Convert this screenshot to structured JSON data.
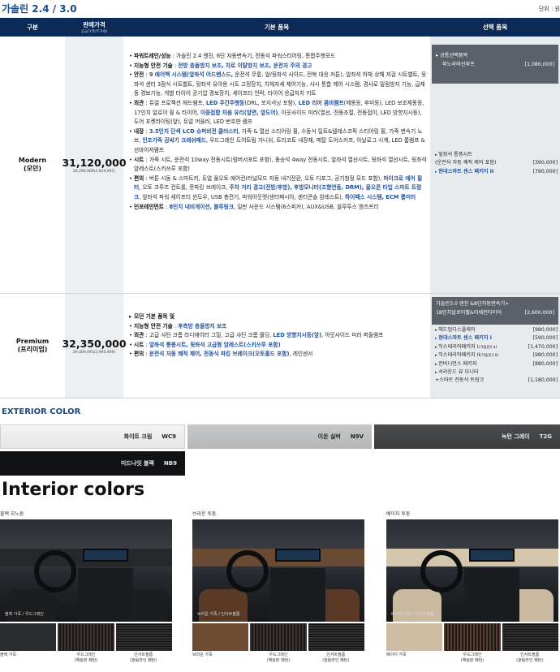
{
  "title": "가솔린 2.4 / 3.0",
  "unit": "단위 : 원",
  "headers": {
    "grade": "구분",
    "price": "판매가격",
    "price_sub": "공급가격(부가세)",
    "basic": "기본 품목",
    "options": "선택 품목"
  },
  "modern": {
    "name": "Modern",
    "name_kr": "(모던)",
    "price": "31,120,000",
    "price_sub": "28,290,909(2,829,091)",
    "basic": [
      {
        "k": "파워트레인/성능",
        "t": " : 가솔린 2.4 엔진, 6단 자동변속기, 전동식 파워스티어링, 통합주행모드",
        "hl": ""
      },
      {
        "k": "지능형 안전 기술",
        "t": " : ",
        "hl": "전방 충돌방지 보조, 차로 이탈방지 보조, 운전자 주의 경고"
      },
      {
        "k": "안전",
        "t": " : ",
        "hl": "9 에어백 시스템(앞좌석 어드밴스드,",
        "t2": " 운전석 무릎, 앞/뒷좌석 사이드, 전복 대응 커튼), 앞좌석 하체 상해 저감 시트벨트, 뒷좌석 센터 3점식 시트벨트, 뒷좌석 유아용 시트 고정장치, 차체자세 제어기능, 샤시 통합 제어 시스템, 경사로 밀림방지 기능, 급제동 경보기능, 개별 타이어 공기압 경보장치, 세이프티 언락, 타이어 응급처치 키트"
      },
      {
        "k": "외관",
        "t": " : 듀얼 프로젝션 헤드램프, ",
        "hl": "LED 주간주행등",
        "t2": "(DRL, 포지셔닝 포함), ",
        "hl2": "LED 리어 콤비램프",
        "t3": "(제동등, 후미등), LED 보조제동등, 17인치 알로이 휠 & 타이어, ",
        "hl3": "이중접합 차음 유리(앞면, 앞도어)",
        "t4": ", 아웃사이드 미러(열선, 전동조절, 전동접이, LED 방향지시등), 도어 포켓라이팅(앞), 듀얼 머플러, LED 번호판 램프"
      },
      {
        "k": "내장",
        "t": " : ",
        "hl": "3.5인치 단색 LCD 슈퍼비전 클러스터",
        "t2": ", 가죽 & 열선 스티어링 휠, 수동식 틸트&텔레스코픽 스티어링 휠, 가죽 변속기 노브, ",
        "hl2": "인조가죽 감싸기 크래쉬패드",
        "t3": ", 우드그레인 도어트림 가니쉬, 트리코트 내장재, 메탈 도어스커프, 아날로그 시계, LED 룸램프 & 선바이저램프"
      },
      {
        "k": "시트",
        "t": " : 가죽 시트, 운전석 10way 전동시트(럼버서포트 포함), 동승석 4way 전동시트, 앞좌석 열선시트, 뒷좌석 열선시트, 뒷좌석 암레스트(스키쓰루 포함)",
        "hl": ""
      },
      {
        "k": "편의",
        "t": " : 버튼 시동 & 스마트키, 듀얼 풀오토 에어컨(터널모드 자동 내기전환, 오토 디포그, 공기청정 모드 포함), ",
        "hl": "마이크로 에어 필터",
        "t2": ", 오토 크루즈 컨트롤, 풋파킹 브레이크, ",
        "hl2": "주차 거리 경고(전방/후방), 후방모니터(조향연동, DRM), 올오픈 타입 스마트 트렁크",
        "t3": ", 앞좌석 파워 세이프티 윈도우, USB 충전기, 파워아웃렛(센터페시아, 센터콘솔 암레스트), ",
        "hl3": "하이패스 시스템, ECM 룸미러"
      },
      {
        "k": "인포테인먼트",
        "t": " : ",
        "hl": "8인치 내비게이션, 블루링크",
        "t2": ", 일반 사운드 시스템(6스피커), AUX&USB, 블루투스 핸즈프리"
      }
    ],
    "opt_box_title": "▸ 공통선택품목",
    "opt_box_item": "파노라마선루프",
    "opt_box_price": "[1,080,000]",
    "options": [
      {
        "n": "앞좌석 통풍시트",
        "p": "",
        "blue": false
      },
      {
        "n": "(운전석 자동 쾌적 제어 포함)",
        "p": "[390,000]",
        "blue": false,
        "cont": true
      },
      {
        "n": "현대스마트 센스 패키지 II",
        "p": "[790,000]",
        "blue": true
      }
    ]
  },
  "premium": {
    "name": "Premium",
    "name_kr": "(프리미엄)",
    "price": "32,350,000",
    "price_sub": "29,409,091(2,940,909)",
    "basic": [
      {
        "k": "모던 기본 품목 및",
        "t": "",
        "hl": ""
      },
      {
        "k": "지능형 안전 기술",
        "t": " : ",
        "hl": "후측방 충돌방지 보조"
      },
      {
        "k": "외관",
        "t": " : 고급 샤틴 크롬 라디에이터 그릴, 고급 샤틴 크롬 몰딩, ",
        "hl": "LED 방향지시등(앞)",
        "t2": ", 아웃사이드 미러 퍼들램프"
      },
      {
        "k": "시트",
        "t": " : ",
        "hl": "앞좌석 통풍시트, 뒷좌석 고급형 암레스트(스키쓰루 포함)"
      },
      {
        "k": "편의",
        "t": " : ",
        "hl": "운전석 자동 쾌적 제어, 전동식 파킹 브레이크(오토홀드 포함)",
        "t2": ", 레인센서"
      }
    ],
    "opt_box_line1": "가솔린3.0 엔진 &8단자동변속기+",
    "opt_box_line2": "18인치알로이휠&미쉐린타이어",
    "opt_box_price": "[2,600,000]",
    "options": [
      {
        "n": "헤드업디스플레이",
        "p": "[980,000]",
        "blue": false
      },
      {
        "n": "현대스마트 센스 패키지 I",
        "p": "[590,000]",
        "blue": true
      },
      {
        "n": "익스테리어패키지 I",
        "s": "(가솔린2.4)",
        "p": "[1,470,000]",
        "blue": false
      },
      {
        "n": "익스테리어패키지 II",
        "s": "(가솔린3.0)",
        "p": "[980,000]",
        "blue": false
      },
      {
        "n": "컨비니언스 패키지",
        "p": "[880,000]",
        "blue": false
      },
      {
        "n": "서라운드 뷰 모니터",
        "p": "",
        "blue": false
      },
      {
        "n": "+스마트 전동식 트렁크",
        "p": "[1,180,000]",
        "blue": false,
        "cont": true
      }
    ]
  },
  "exterior": {
    "title": "EXTERIOR COLOR",
    "colors": [
      {
        "name": "화이트 크림",
        "code": "WC9"
      },
      {
        "name": "이온 실버",
        "code": "N9V"
      },
      {
        "name": "녹턴 그레이",
        "code": "T2G"
      },
      {
        "name": "미드나잇 블랙",
        "code": "NB9"
      }
    ]
  },
  "interior": {
    "title": "Interior colors",
    "cols": [
      {
        "label": "블랙 모노톤",
        "caption": "블랙 가죽 / 우드그레인",
        "chips": [
          "블랙 가죽",
          "우드그레인\n(헤링본 패턴)",
          "인서트필름\n(슬림라인 패턴)"
        ],
        "seat": "#1c1d1f",
        "dash": "#26282b",
        "c1": "#2b2c2e",
        "c2": "#3a3532",
        "c3": "#2e2f31"
      },
      {
        "label": "브라운 투톤",
        "caption": "브라운 가죽 / 인서트필름",
        "chips": [
          "브라운 가죽",
          "우드그레인\n(헤링본 패턴)",
          "인서트필름\n(슬림라인 패턴)"
        ],
        "seat": "#5a3a26",
        "dash": "#6b4a33",
        "c1": "#6e4a31",
        "c2": "#3a3532",
        "c3": "#2e2f31"
      },
      {
        "label": "베이지 투톤",
        "caption": "베이지 가죽 / 인서트필름",
        "chips": [
          "베이지 가죽",
          "우드그레인\n(헤링본 패턴)",
          "인서트필름\n(슬림라인 패턴)"
        ],
        "seat": "#c9b9a1",
        "dash": "#d4c5ad",
        "c1": "#cdbda5",
        "c2": "#5a4030",
        "c3": "#2e2f31"
      }
    ]
  }
}
